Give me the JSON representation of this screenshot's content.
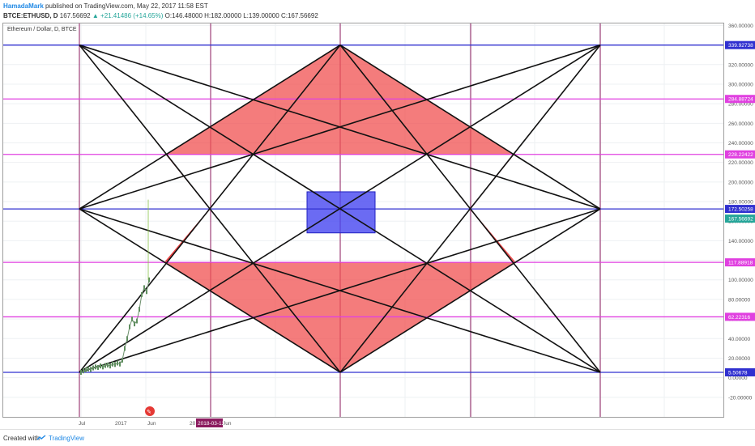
{
  "header": {
    "author": "HamadaMark",
    "published_text": "published on TradingView.com, May 22, 2017 11:58 EST",
    "symbol": "BTCE:ETHUSD, D",
    "last": "167.56692",
    "change": "+21.41486 (+14.65%)",
    "open": "O:146.48000",
    "high": "H:182.00000",
    "low": "L:139.00000",
    "close": "C:167.56692"
  },
  "footer": {
    "created_with": "Created with",
    "brand": "TradingView"
  },
  "chart_data": {
    "type": "line",
    "title": "Ethereum / Dollar, D, BTCE",
    "ylim": [
      -40,
      362
    ],
    "yticks": [
      "-20.00000",
      "0.00000",
      "20.00000",
      "40.00000",
      "60.00000",
      "80.00000",
      "100.00000",
      "120.00000",
      "140.00000",
      "160.00000",
      "180.00000",
      "200.00000",
      "220.00000",
      "240.00000",
      "260.00000",
      "280.00000",
      "300.00000",
      "320.00000",
      "340.00000",
      "360.00000"
    ],
    "xticks": [
      "Jul",
      "2017",
      "Jun",
      "20",
      "Jun"
    ],
    "cursor_label": "2018-03-12",
    "price_label": "167.56692",
    "horizontal_levels": [
      {
        "value": 339.92738,
        "label": "339.92738",
        "color": "#3030d0"
      },
      {
        "value": 284.88724,
        "label": "284.88724",
        "color": "#e040e0"
      },
      {
        "value": 228.22422,
        "label": "228.22422",
        "color": "#e040e0"
      },
      {
        "value": 172.50258,
        "label": "172.50258",
        "color": "#3030d0"
      },
      {
        "value": 117.88918,
        "label": "117.88918",
        "color": "#e040e0"
      },
      {
        "value": 62.22316,
        "label": "62.22316",
        "color": "#e040e0"
      },
      {
        "value": 5.50678,
        "label": "5.50678",
        "color": "#3030d0"
      }
    ],
    "price_series": {
      "y": [
        5.5,
        7,
        8,
        9,
        8.5,
        10,
        11,
        10.5,
        12,
        11,
        12.5,
        13,
        12,
        14,
        13.5,
        15,
        14,
        18,
        30,
        40,
        52,
        60,
        55,
        58,
        70,
        85,
        92,
        88,
        100
      ]
    }
  }
}
